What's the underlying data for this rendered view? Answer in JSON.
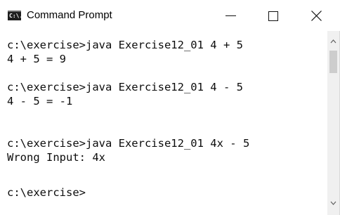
{
  "window": {
    "title": "Command Prompt",
    "app_icon_text": "C:\\."
  },
  "console": {
    "lines": [
      "c:\\exercise>java Exercise12_01 4 + 5",
      "4 + 5 = 9",
      "",
      "c:\\exercise>java Exercise12_01 4 - 5",
      "4 - 5 = -1",
      "",
      "c:\\exercise>java Exercise12_01 4x - 5",
      "Wrong Input: 4x",
      "",
      "c:\\exercise>"
    ]
  },
  "controls": {
    "minimize_icon": "minimize-icon",
    "maximize_icon": "maximize-icon",
    "close_icon": "close-icon"
  },
  "colors": {
    "background": "#ffffff",
    "text": "#0c0c0c",
    "scrollbar_track": "#f0f0f0",
    "scrollbar_thumb": "#cdcdcd"
  }
}
